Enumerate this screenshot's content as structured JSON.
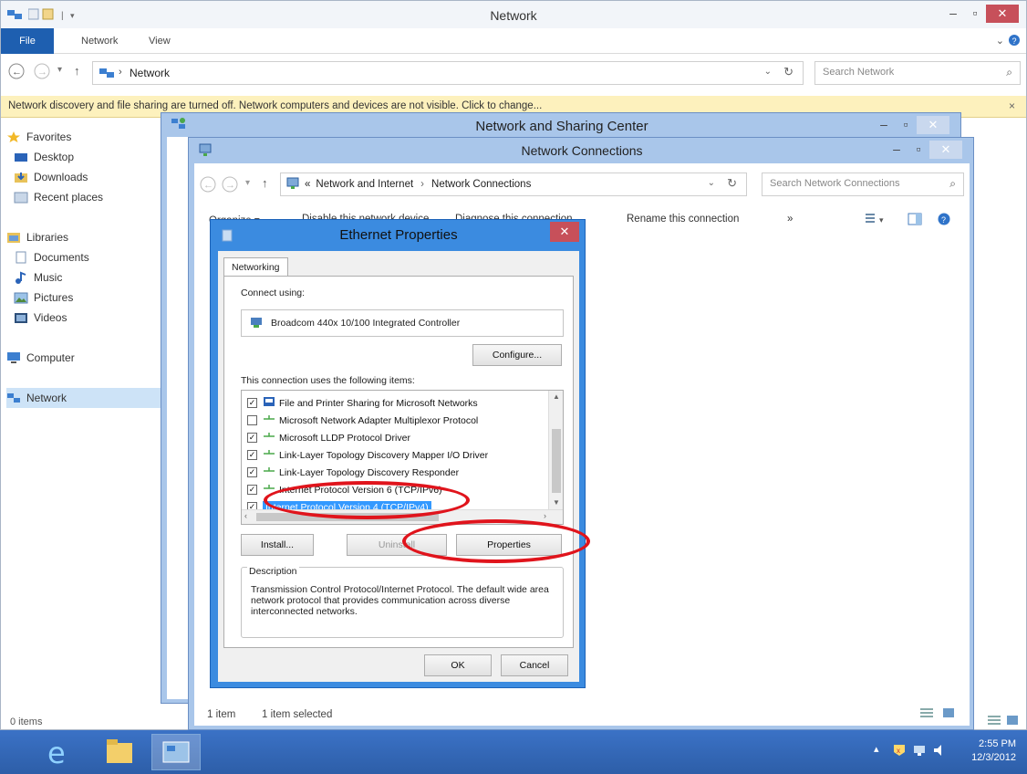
{
  "explorer": {
    "title": "Network",
    "ribbon": {
      "file": "File",
      "tabs": [
        "Network",
        "View"
      ]
    },
    "address": {
      "path": "Network",
      "search_placeholder": "Search Network"
    },
    "banner": "Network discovery and file sharing are turned off. Network computers and devices are not visible. Click to change...",
    "nav": {
      "favorites": "Favorites",
      "fav_items": [
        "Desktop",
        "Downloads",
        "Recent places"
      ],
      "libraries": "Libraries",
      "lib_items": [
        "Documents",
        "Music",
        "Pictures",
        "Videos"
      ],
      "computer": "Computer",
      "network": "Network"
    },
    "status": "0 items"
  },
  "nsc": {
    "title": "Network and Sharing Center"
  },
  "ncon": {
    "title": "Network Connections",
    "breadcrumb": {
      "prefix": "«",
      "parent": "Network and Internet",
      "sep": "›",
      "current": "Network Connections"
    },
    "search_placeholder": "Search Network Connections",
    "toolbar": {
      "organize": "Organize ▾",
      "disable": "Disable this network device",
      "diagnose": "Diagnose this connection",
      "rename": "Rename this connection",
      "more": "»"
    },
    "status": {
      "count": "1 item",
      "selected": "1 item selected"
    }
  },
  "eth": {
    "title": "Ethernet Properties",
    "tab": "Networking",
    "connect_using_label": "Connect using:",
    "adapter": "Broadcom 440x 10/100 Integrated Controller",
    "configure": "Configure...",
    "items_label": "This connection uses the following items:",
    "items": [
      {
        "label": "File and Printer Sharing for Microsoft Networks",
        "checked": true
      },
      {
        "label": "Microsoft Network Adapter Multiplexor Protocol",
        "checked": false
      },
      {
        "label": "Microsoft LLDP Protocol Driver",
        "checked": true
      },
      {
        "label": "Link-Layer Topology Discovery Mapper I/O Driver",
        "checked": true
      },
      {
        "label": "Link-Layer Topology Discovery Responder",
        "checked": true
      },
      {
        "label": "Internet Protocol Version 6 (TCP/IPv6)",
        "checked": true
      },
      {
        "label": "Internet Protocol Version 4 (TCP/IPv4)",
        "checked": true,
        "selected": true
      }
    ],
    "install": "Install...",
    "uninstall": "Uninstall",
    "properties": "Properties",
    "description_label": "Description",
    "description": "Transmission Control Protocol/Internet Protocol. The default wide area network protocol that provides communication across diverse interconnected networks.",
    "ok": "OK",
    "cancel": "Cancel"
  },
  "taskbar": {
    "time": "2:55 PM",
    "date": "12/3/2012"
  },
  "colors": {
    "highlight": "#3399ff",
    "annotation": "#e0141c",
    "taskbar": "#2d5ea8"
  }
}
